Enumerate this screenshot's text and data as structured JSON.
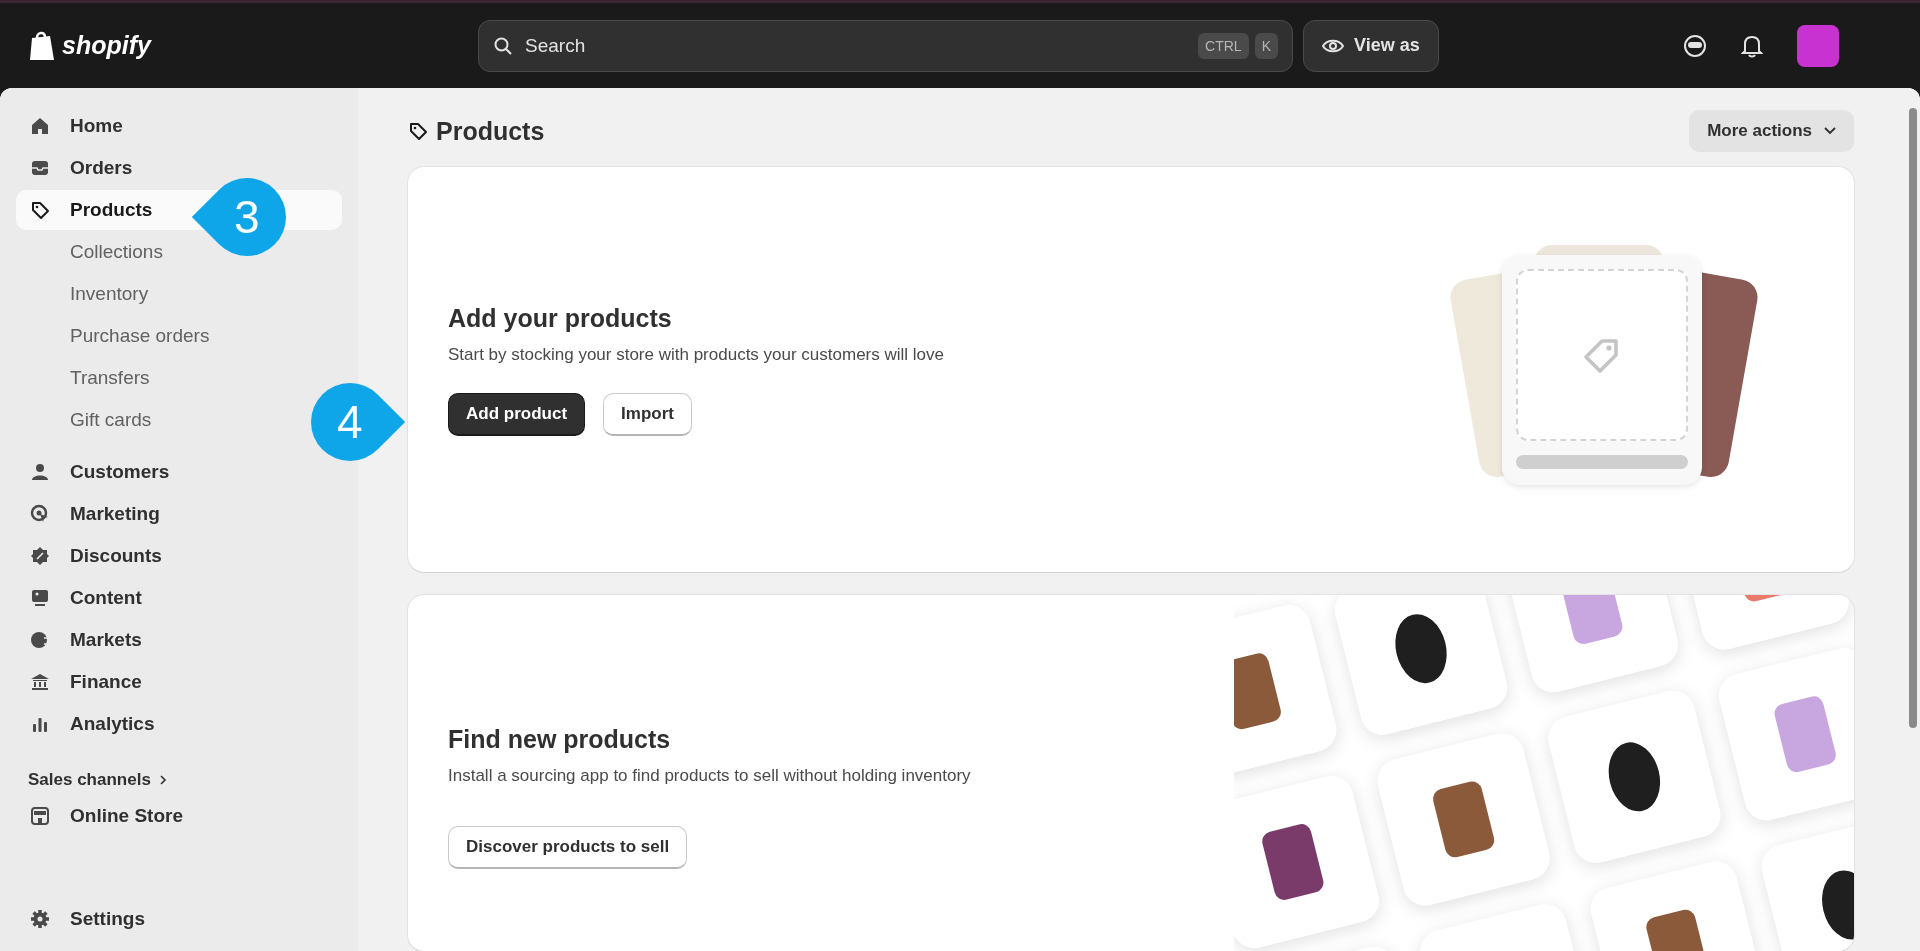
{
  "topbar": {
    "logo": "shopify",
    "search": {
      "placeholder": "Search",
      "keys": [
        "CTRL",
        "K"
      ]
    },
    "view_as": "View as"
  },
  "sidebar": {
    "items": [
      {
        "label": "Home",
        "selected": false
      },
      {
        "label": "Orders",
        "selected": false
      },
      {
        "label": "Products",
        "selected": true,
        "children": [
          {
            "label": "Collections"
          },
          {
            "label": "Inventory"
          },
          {
            "label": "Purchase orders"
          },
          {
            "label": "Transfers"
          },
          {
            "label": "Gift cards"
          }
        ]
      },
      {
        "label": "Customers",
        "selected": false
      },
      {
        "label": "Marketing",
        "selected": false
      },
      {
        "label": "Discounts",
        "selected": false
      },
      {
        "label": "Content",
        "selected": false
      },
      {
        "label": "Markets",
        "selected": false
      },
      {
        "label": "Finance",
        "selected": false
      },
      {
        "label": "Analytics",
        "selected": false
      }
    ],
    "sales_channels": {
      "heading": "Sales channels",
      "items": [
        {
          "label": "Online Store"
        }
      ]
    },
    "settings": "Settings"
  },
  "page": {
    "title": "Products",
    "more_actions": "More actions"
  },
  "cards": [
    {
      "kind": "add",
      "heading": "Add your products",
      "text": "Start by stocking your store with products your customers will love",
      "buttons": [
        {
          "label": "Add product",
          "primary": true
        },
        {
          "label": "Import",
          "primary": false
        }
      ]
    },
    {
      "kind": "find",
      "heading": "Find new products",
      "text": "Install a sourcing app to find products to sell without holding inventory",
      "buttons": [
        {
          "label": "Discover products to sell",
          "primary": false
        }
      ]
    }
  ],
  "callouts": [
    {
      "number": "3"
    },
    {
      "number": "4"
    }
  ]
}
